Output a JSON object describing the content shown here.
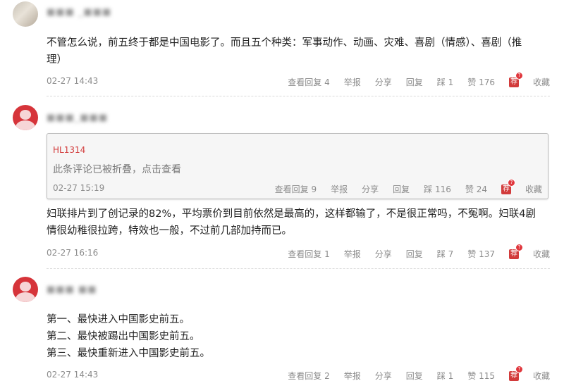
{
  "comments": [
    {
      "username": "■■■ _■■■",
      "text": "不管怎么说，前五终于都是中国电影了。而且五个种类：军事动作、动画、灾难、喜剧（情感）、喜剧（推\n理）",
      "time": "02-27 14:43",
      "view_replies": "查看回复 4",
      "report": "举报",
      "share": "分享",
      "reply": "回复",
      "dislike": "踩 1",
      "like": "赞 176",
      "recommend": "荐",
      "collect": "收藏"
    },
    {
      "username": "■■■_■■■",
      "folded": {
        "username": "HL1314",
        "note": "此条评论已被折叠，点击查看",
        "time": "02-27 15:19",
        "view_replies": "查看回复 9",
        "report": "举报",
        "share": "分享",
        "reply": "回复",
        "dislike": "踩 116",
        "like": "赞 24",
        "recommend": "荐",
        "collect": "收藏"
      },
      "text": "妇联排片到了创记录的82%，平均票价到目前依然是最高的，这样都输了，不是很正常吗，不冤啊。妇联4剧\n情很幼稚很拉跨，特效也一般，不过前几部加持而已。",
      "time": "02-27 16:16",
      "view_replies": "查看回复 1",
      "report": "举报",
      "share": "分享",
      "reply": "回复",
      "dislike": "踩 7",
      "like": "赞 137",
      "recommend": "荐",
      "collect": "收藏"
    },
    {
      "username": "■■■ ■■",
      "text": "第一、最快进入中国影史前五。\n第二、最快被踢出中国影史前五。\n第三、最快重新进入中国影史前五。",
      "time": "02-27 14:43",
      "view_replies": "查看回复 2",
      "report": "举报",
      "share": "分享",
      "reply": "回复",
      "dislike": "踩 1",
      "like": "赞 115",
      "recommend": "荐",
      "collect": "收藏"
    }
  ]
}
